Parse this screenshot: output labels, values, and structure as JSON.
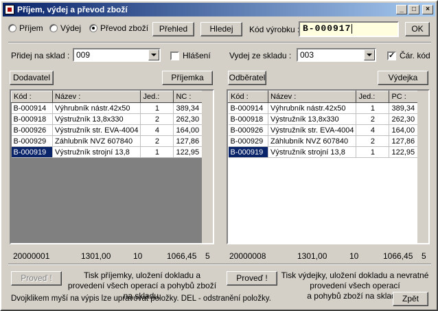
{
  "window": {
    "title": "Příjem, výdej a převod zboží",
    "controls": [
      "_",
      "□",
      "×"
    ]
  },
  "mode": {
    "options": [
      {
        "label": "Příjem",
        "selected": false
      },
      {
        "label": "Výdej",
        "selected": false
      },
      {
        "label": "Převod zboží",
        "selected": true
      }
    ]
  },
  "toolbar": {
    "overview_label": "Přehled",
    "search_label": "Hledej",
    "code_label": "Kód výrobku :",
    "code_value": "B-000917",
    "ok_label": "OK"
  },
  "receipt": {
    "warehouse_label": "Přidej na sklad :",
    "warehouse_value": "009",
    "report_label": "Hlášení",
    "report_checked": false,
    "supplier_label": "Dodavatel",
    "receipt_button_label": "Příjemka",
    "columns": [
      "Kód :",
      "Název :",
      "Jed.:",
      "NC :"
    ],
    "rows": [
      [
        "B-000914",
        "Výhrubník nástr.42x50",
        "1",
        "389,34"
      ],
      [
        "B-000918",
        "Výstružník 13,8x330",
        "2",
        "262,30"
      ],
      [
        "B-000926",
        "Výstružník str. EVA-4004",
        "4",
        "164,00"
      ],
      [
        "B-000929",
        "Záhlubník NVZ 607840",
        "2",
        "127,86"
      ],
      [
        "B-000919",
        "Výstružník strojní 13,8",
        "1",
        "122,95"
      ]
    ],
    "footer": {
      "doc": "20000001",
      "sum": "1301,00",
      "qty": "10",
      "total": "1066,45",
      "count": "5"
    },
    "submit_label": "Proveď !",
    "note": "Tisk příjemky, uložení dokladu a provedení všech operací a pohybů zboží na skladu."
  },
  "issue": {
    "warehouse_label": "Vydej ze skladu :",
    "warehouse_value": "003",
    "barcode_label": "Čár. kód",
    "barcode_checked": true,
    "customer_label": "Odběratel",
    "issue_button_label": "Výdejka",
    "columns": [
      "Kód :",
      "Název :",
      "Jed.:",
      "PC :"
    ],
    "rows": [
      [
        "B-000914",
        "Výhrubník nástr.42x50",
        "1",
        "389,34"
      ],
      [
        "B-000918",
        "Výstružník 13,8x330",
        "2",
        "262,30"
      ],
      [
        "B-000926",
        "Výstružník str. EVA-4004",
        "4",
        "164,00"
      ],
      [
        "B-000929",
        "Záhlubník NVZ 607840",
        "2",
        "127,86"
      ],
      [
        "B-000919",
        "Výstružník strojní 13,8",
        "1",
        "122,95"
      ]
    ],
    "footer": {
      "doc": "20000008",
      "sum": "1301,00",
      "qty": "10",
      "total": "1066,45",
      "count": "5"
    },
    "submit_label": "Proveď !",
    "note_line1": "Tisk výdejky, uložení dokladu a nevratné",
    "note_line2": "provedení všech operací",
    "note_line3": "a pohybů zboží na skladu."
  },
  "hint": "Dvojklikem myší na výpis lze upravovat položky. DEL - odstranění položky.",
  "back_label": "Zpět"
}
